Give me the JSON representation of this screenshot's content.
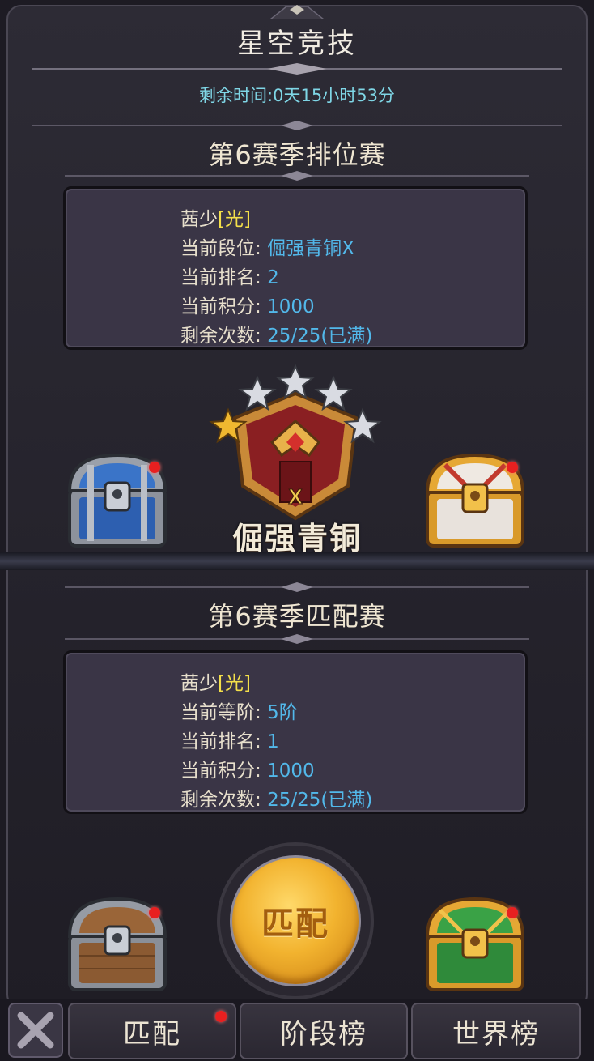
{
  "header": {
    "title": "星空竞技",
    "timer": "剩余时间:0天15小时53分"
  },
  "ranked": {
    "title": "第6赛季排位赛",
    "player_name": "茜少",
    "player_tag": "[光]",
    "rows": [
      {
        "label": "当前段位:",
        "value": "倔强青铜X"
      },
      {
        "label": "当前排名:",
        "value": "2"
      },
      {
        "label": "当前积分:",
        "value": "1000"
      },
      {
        "label": "剩余次数:",
        "value": "25/25(已满)"
      }
    ],
    "rank_name": "倔强青铜",
    "rank_numeral": "X",
    "stars_filled": 1,
    "stars_total": 5
  },
  "match": {
    "title": "第6赛季匹配赛",
    "player_name": "茜少",
    "player_tag": "[光]",
    "rows": [
      {
        "label": "当前等阶:",
        "value": "5阶"
      },
      {
        "label": "当前排名:",
        "value": "1"
      },
      {
        "label": "当前积分:",
        "value": "1000"
      },
      {
        "label": "剩余次数:",
        "value": "25/25(已满)"
      }
    ],
    "button_label": "匹配"
  },
  "tabs": [
    {
      "label": "匹配",
      "has_dot": true
    },
    {
      "label": "阶段榜",
      "has_dot": false
    },
    {
      "label": "世界榜",
      "has_dot": false
    }
  ],
  "colors": {
    "label": "#e7dfcc",
    "value": "#52b8ea",
    "tag": "#f4e04a",
    "timer": "#7fd6e6",
    "notification": "#e82020"
  },
  "icons": {
    "close": "close-x-icon",
    "chests": [
      "silver-chest-icon",
      "gold-chest-icon",
      "wooden-chest-icon",
      "green-chest-icon"
    ],
    "emblem": "bronze-rank-emblem-icon"
  }
}
